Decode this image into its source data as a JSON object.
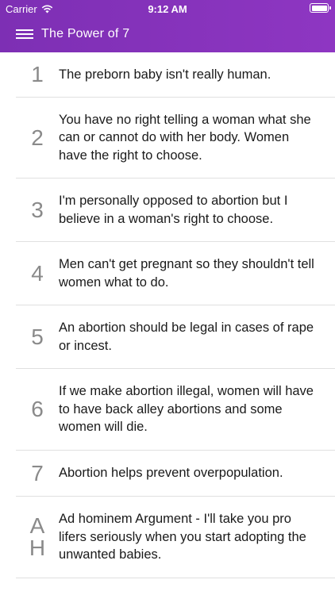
{
  "status": {
    "carrier": "Carrier",
    "time": "9:12 AM",
    "battery_level": 1.0
  },
  "nav": {
    "title": "The Power of 7",
    "menu_icon": "hamburger-icon"
  },
  "items": [
    {
      "number": "1",
      "text": "The preborn baby isn't really human."
    },
    {
      "number": "2",
      "text": "You have no right telling a woman what she can or cannot do with her body. Women have the right to choose."
    },
    {
      "number": "3",
      "text": "I'm personally opposed to abortion but I believe in a woman's right to choose."
    },
    {
      "number": "4",
      "text": "Men can't get pregnant so they shouldn't tell women what to do."
    },
    {
      "number": "5",
      "text": "An abortion should be legal in cases of rape or incest."
    },
    {
      "number": "6",
      "text": "If we make abortion illegal, women will have to have back alley abortions and some women will die."
    },
    {
      "number": "7",
      "text": "Abortion helps prevent overpopulation."
    },
    {
      "number_line1": "A",
      "number_line2": "H",
      "text": "Ad hominem Argument - I'll take you pro lifers seriously when you start adopting the unwanted babies."
    }
  ],
  "colors": {
    "header": "#8a34bf",
    "number": "#8a8a8a",
    "text": "#1a1a1a",
    "divider": "#e0e0e0"
  }
}
